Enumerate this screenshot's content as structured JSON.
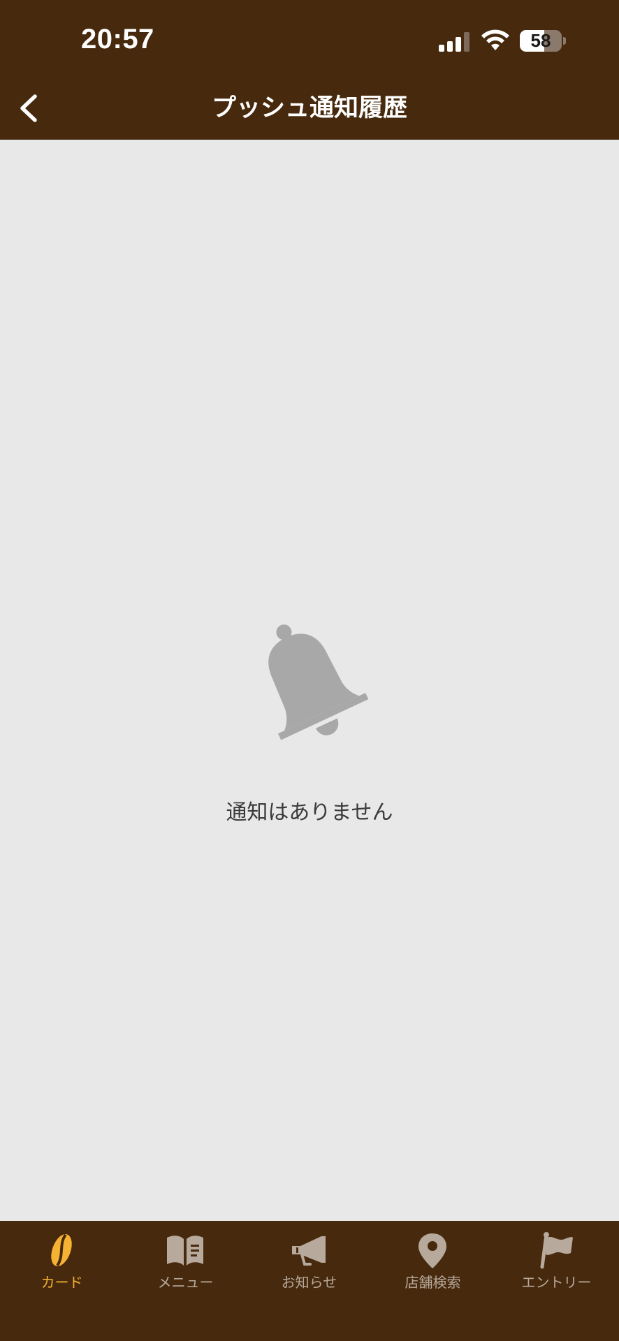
{
  "status_bar": {
    "time": "20:57",
    "battery": "58",
    "battery_level": 0.58
  },
  "header": {
    "title": "プッシュ通知履歴",
    "back_icon": "chevron-left-icon"
  },
  "empty_state": {
    "icon": "bell-off-icon",
    "message": "通知はありません"
  },
  "tabbar": {
    "active_color": "#f6b233",
    "inactive_color": "#b7a99c",
    "items": [
      {
        "label": "カード",
        "icon": "coffee-bean-icon",
        "active": true
      },
      {
        "label": "メニュー",
        "icon": "menu-book-icon",
        "active": false
      },
      {
        "label": "お知らせ",
        "icon": "megaphone-icon",
        "active": false
      },
      {
        "label": "店舗検索",
        "icon": "map-pin-icon",
        "active": false
      },
      {
        "label": "エントリー",
        "icon": "flag-icon",
        "active": false
      }
    ]
  },
  "colors": {
    "header_bg": "#472a0d",
    "content_bg": "#e8e8e8",
    "icon_gray": "#a8a8a8"
  }
}
